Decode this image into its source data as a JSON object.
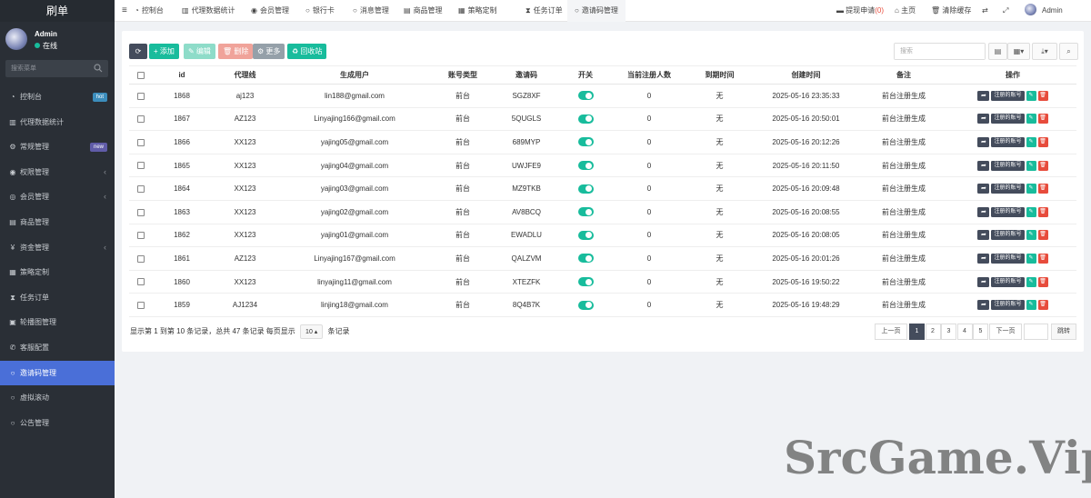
{
  "brand": "刷单",
  "user": {
    "name": "Admin",
    "status": "在线"
  },
  "sidebar": {
    "search_placeholder": "搜索菜单",
    "items": [
      {
        "icon": "dashboard-icon",
        "glyph": "◔",
        "label": "控制台",
        "badge": "hot"
      },
      {
        "icon": "bar-chart-icon",
        "glyph": "▥",
        "label": "代理数据统计"
      },
      {
        "icon": "cogs-icon",
        "glyph": "⚙",
        "label": "常规管理",
        "badge": "new"
      },
      {
        "icon": "group-icon",
        "glyph": "◉",
        "label": "权限管理",
        "caret": true
      },
      {
        "icon": "user-circle-icon",
        "glyph": "◎",
        "label": "会员管理",
        "caret": true
      },
      {
        "icon": "shop-icon",
        "glyph": "▤",
        "label": "商品管理"
      },
      {
        "icon": "yen-icon",
        "glyph": "¥",
        "label": "资金管理",
        "caret": true
      },
      {
        "icon": "chart-icon",
        "glyph": "▦",
        "label": "策略定制"
      },
      {
        "icon": "hourglass-icon",
        "glyph": "⧗",
        "label": "任务订单"
      },
      {
        "icon": "image-icon",
        "glyph": "▣",
        "label": "轮播图管理"
      },
      {
        "icon": "support-icon",
        "glyph": "✆",
        "label": "客服配置"
      },
      {
        "icon": "circle-icon",
        "glyph": "○",
        "label": "邀请码管理",
        "active": true
      },
      {
        "icon": "circle-icon",
        "glyph": "○",
        "label": "虚拟滚动"
      },
      {
        "icon": "circle-icon",
        "glyph": "○",
        "label": "公告管理"
      }
    ]
  },
  "topnav": {
    "menu_glyph": "≡",
    "tabs": [
      {
        "icon": "dashboard-icon",
        "glyph": "◔",
        "label": "控制台"
      },
      {
        "icon": "bar-chart-icon",
        "glyph": "▥",
        "label": "代理数据统计"
      },
      {
        "icon": "user-icon",
        "glyph": "◉",
        "label": "会员管理"
      },
      {
        "icon": "circle-icon",
        "glyph": "○",
        "label": "银行卡"
      },
      {
        "icon": "circle-icon",
        "glyph": "○",
        "label": "消息管理"
      },
      {
        "icon": "shop-icon",
        "glyph": "▤",
        "label": "商品管理"
      },
      {
        "icon": "chart-icon",
        "glyph": "▦",
        "label": "策略定制"
      },
      {
        "icon": "hourglass-icon",
        "glyph": "⧗",
        "label": "任务订单"
      },
      {
        "icon": "circle-icon",
        "glyph": "○",
        "label": "邀请码管理",
        "active": true
      }
    ],
    "withdraw_label": "提现申请",
    "withdraw_count": "(0)",
    "home_label": "主页",
    "clear_cache_label": "清除缓存",
    "admin_label": "Admin"
  },
  "toolbar": {
    "refresh_glyph": "⟳",
    "add_label": "+ 添加",
    "edit_label": "✎ 编辑",
    "delete_label": "🗑 删除",
    "more_label": "⚙ 更多",
    "recycle_label": "♻ 回收站",
    "search_placeholder": "搜索"
  },
  "table": {
    "columns": [
      "id",
      "代理线",
      "生成用户",
      "账号类型",
      "邀请码",
      "开关",
      "当前注册人数",
      "到期时间",
      "创建时间",
      "备注",
      "操作"
    ],
    "action_label": "注册的账号",
    "rows": [
      [
        "1868",
        "aj123",
        "lin188@gmail.com",
        "前台",
        "SGZ8XF",
        "0",
        "无",
        "2025-05-16 23:35:33",
        "前台注册生成"
      ],
      [
        "1867",
        "AZ123",
        "Linyajing166@gmail.com",
        "前台",
        "5QUGLS",
        "0",
        "无",
        "2025-05-16 20:50:01",
        "前台注册生成"
      ],
      [
        "1866",
        "XX123",
        "yajing05@gmail.com",
        "前台",
        "689MYP",
        "0",
        "无",
        "2025-05-16 20:12:26",
        "前台注册生成"
      ],
      [
        "1865",
        "XX123",
        "yajing04@gmail.com",
        "前台",
        "UWJFE9",
        "0",
        "无",
        "2025-05-16 20:11:50",
        "前台注册生成"
      ],
      [
        "1864",
        "XX123",
        "yajing03@gmail.com",
        "前台",
        "MZ9TKB",
        "0",
        "无",
        "2025-05-16 20:09:48",
        "前台注册生成"
      ],
      [
        "1863",
        "XX123",
        "yajing02@gmail.com",
        "前台",
        "AV8BCQ",
        "0",
        "无",
        "2025-05-16 20:08:55",
        "前台注册生成"
      ],
      [
        "1862",
        "XX123",
        "yajing01@gmail.com",
        "前台",
        "EWADLU",
        "0",
        "无",
        "2025-05-16 20:08:05",
        "前台注册生成"
      ],
      [
        "1861",
        "AZ123",
        "Linyajing167@gmail.com",
        "前台",
        "QALZVM",
        "0",
        "无",
        "2025-05-16 20:01:26",
        "前台注册生成"
      ],
      [
        "1860",
        "XX123",
        "linyajing11@gmail.com",
        "前台",
        "XTEZFK",
        "0",
        "无",
        "2025-05-16 19:50:22",
        "前台注册生成"
      ],
      [
        "1859",
        "AJ1234",
        "linjing18@gmail.com",
        "前台",
        "8Q4B7K",
        "0",
        "无",
        "2025-05-16 19:48:29",
        "前台注册生成"
      ]
    ]
  },
  "footer": {
    "info_prefix": "显示第 1 到第 10 条记录，总共 47 条记录 每页显示",
    "page_size": "10 ▴",
    "info_suffix": "条记录",
    "prev_label": "上一页",
    "pages": [
      "1",
      "2",
      "3",
      "4",
      "5"
    ],
    "current_page": "1",
    "next_label": "下一页",
    "jump_label": "跳转"
  },
  "watermark": "SrcGame.Vip",
  "colors": {
    "sidebar_bg": "#2a2f36",
    "active": "#4a6fd8",
    "primary": "#18bc9c",
    "danger": "#e74c3c",
    "dark": "#444c5c"
  }
}
